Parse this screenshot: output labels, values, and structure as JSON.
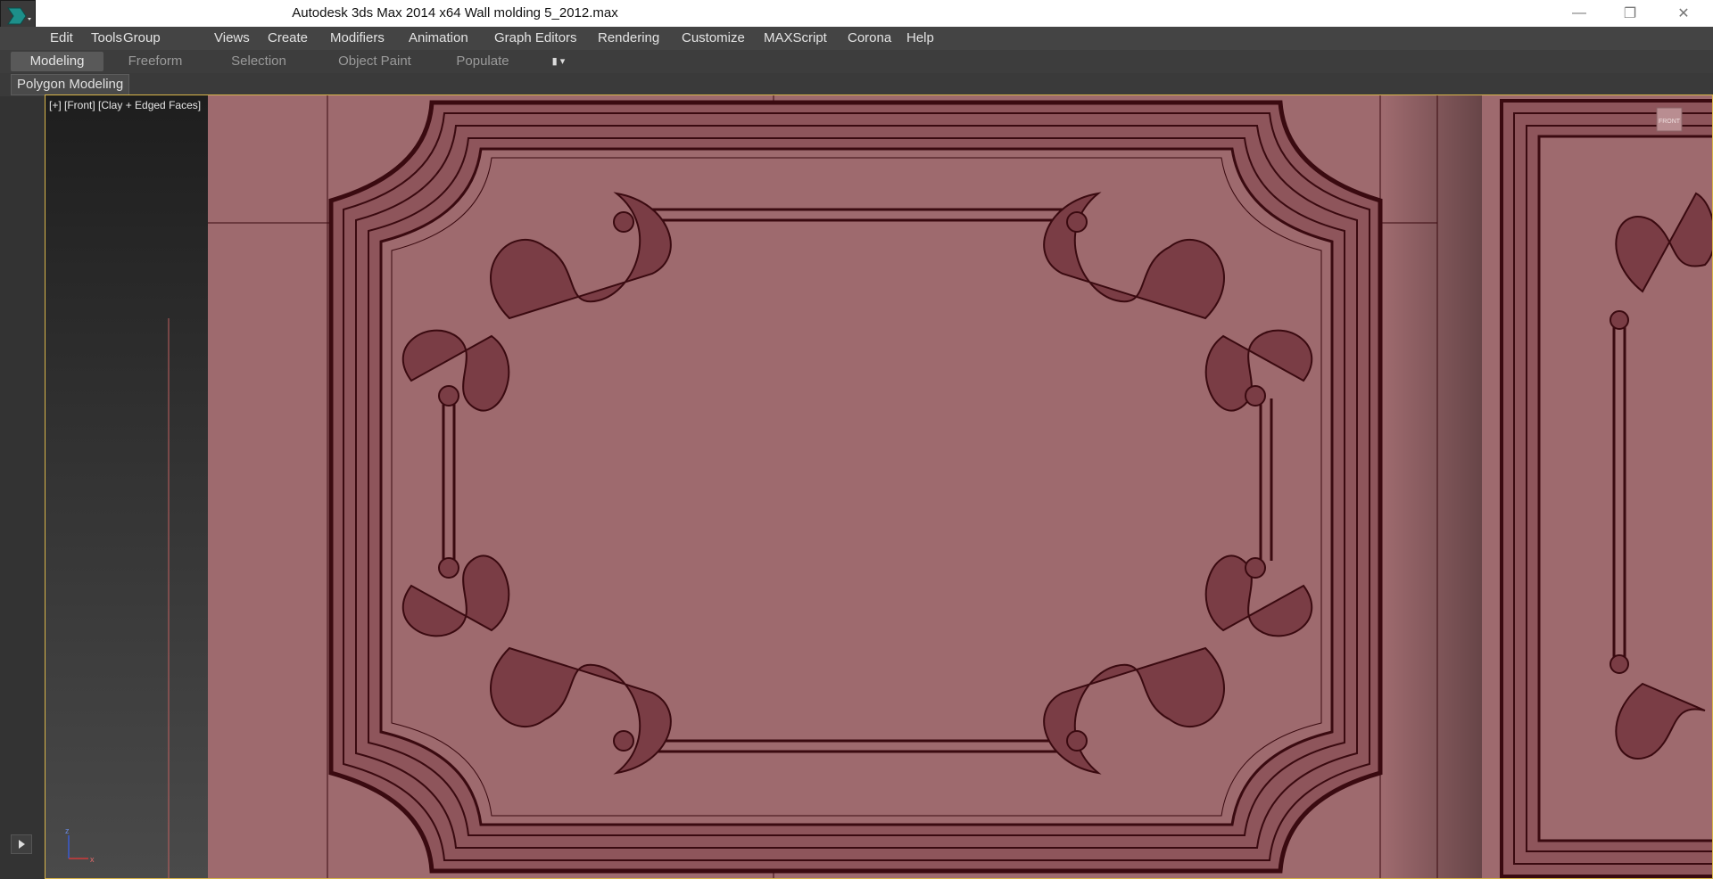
{
  "window": {
    "title": "Autodesk 3ds Max  2014 x64      Wall molding 5_2012.max",
    "controls": {
      "minimize": "minimize-icon",
      "restore": "restore-icon",
      "close": "close-icon"
    }
  },
  "menubar": {
    "items": [
      {
        "label": "Edit"
      },
      {
        "label": "Tools"
      },
      {
        "label": "Group"
      },
      {
        "label": "Views"
      },
      {
        "label": "Create"
      },
      {
        "label": "Modifiers"
      },
      {
        "label": "Animation"
      },
      {
        "label": "Graph Editors"
      },
      {
        "label": "Rendering"
      },
      {
        "label": "Customize"
      },
      {
        "label": "MAXScript"
      },
      {
        "label": "Corona"
      },
      {
        "label": "Help"
      }
    ]
  },
  "ribbon": {
    "tabs": [
      {
        "label": "Modeling",
        "active": true
      },
      {
        "label": "Freeform",
        "active": false
      },
      {
        "label": "Selection",
        "active": false
      },
      {
        "label": "Object Paint",
        "active": false
      },
      {
        "label": "Populate",
        "active": false
      }
    ],
    "panel_label": "Polygon Modeling"
  },
  "viewport": {
    "label": "[+] [Front] [Clay + Edged Faces]",
    "viewcube_label": "FRONT",
    "axis": {
      "vertical": "z",
      "horizontal": "x"
    }
  },
  "colors": {
    "model": "#9e6a6e",
    "wire": "#3a0a10",
    "menubar": "#444444",
    "active_border": "#d9b64a"
  }
}
